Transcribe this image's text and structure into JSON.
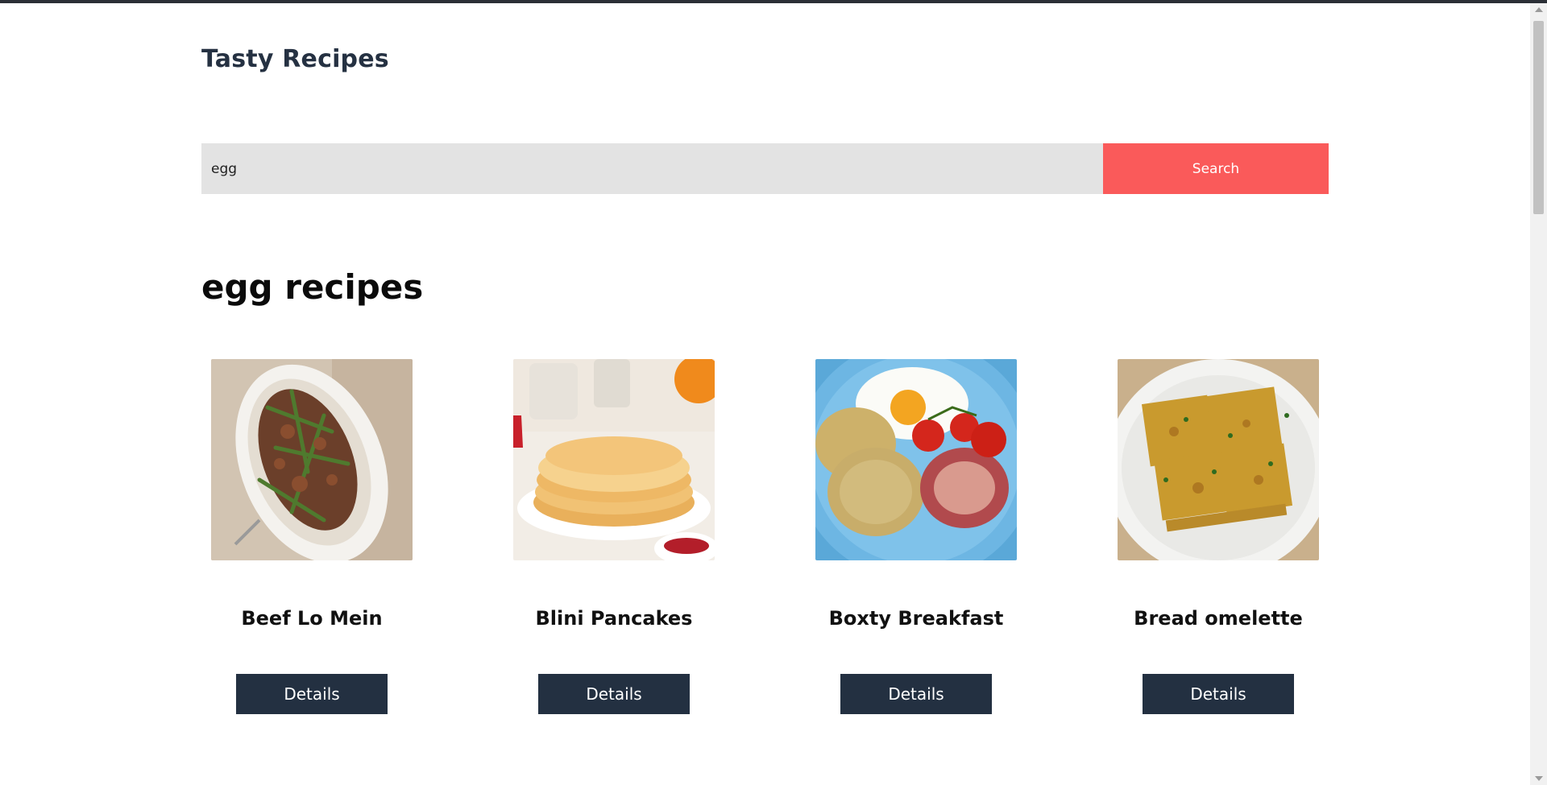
{
  "header": {
    "brand": "Tasty Recipes"
  },
  "search": {
    "value": "egg",
    "button_label": "Search"
  },
  "results": {
    "heading": "egg recipes",
    "items": [
      {
        "title": "Beef Lo Mein",
        "image": "beef-lo-mein-photo",
        "button_label": "Details"
      },
      {
        "title": "Blini Pancakes",
        "image": "blini-pancakes-photo",
        "button_label": "Details"
      },
      {
        "title": "Boxty Breakfast",
        "image": "boxty-breakfast-photo",
        "button_label": "Details"
      },
      {
        "title": "Bread omelette",
        "image": "bread-omelette-photo",
        "button_label": "Details"
      }
    ]
  },
  "colors": {
    "brand_text": "#253142",
    "search_field_bg": "#e3e3e3",
    "search_button_bg": "#fa5a5a",
    "details_button_bg": "#233041"
  }
}
